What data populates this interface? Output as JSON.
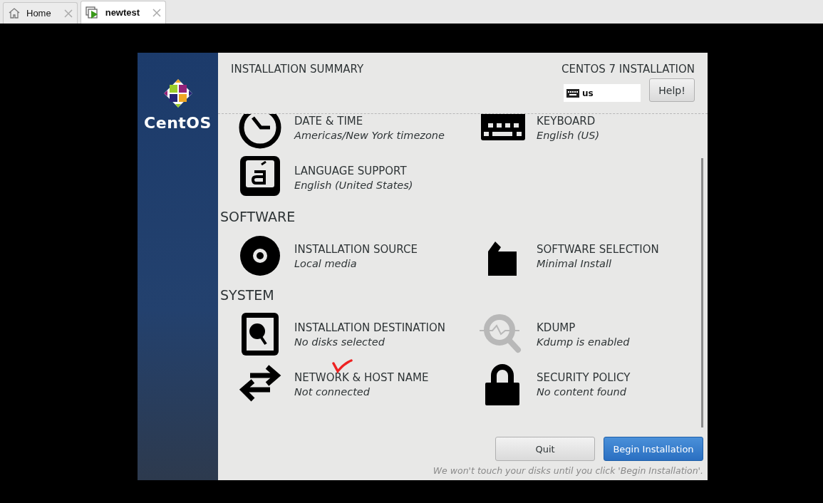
{
  "tabs": [
    {
      "kind": "home",
      "label": "Home",
      "selected": false
    },
    {
      "kind": "vm",
      "label": "newtest",
      "selected": true
    }
  ],
  "sidebar": {
    "logo_text": "CentOS"
  },
  "header": {
    "title": "INSTALLATION SUMMARY",
    "product": "CENTOS 7 INSTALLATION",
    "keyboard_layout": "us",
    "help_button": "Help!"
  },
  "sections": [
    {
      "spokes": [
        {
          "kind": "clock",
          "title": "DATE & TIME",
          "status": "Americas/New York timezone",
          "disabled": false
        },
        {
          "kind": "keyboard",
          "title": "KEYBOARD",
          "status": "English (US)",
          "disabled": false
        },
        {
          "kind": "language",
          "title": "LANGUAGE SUPPORT",
          "status": "English (United States)",
          "disabled": false
        }
      ]
    },
    {
      "heading": "SOFTWARE",
      "spokes": [
        {
          "kind": "disc",
          "title": "INSTALLATION SOURCE",
          "status": "Local media",
          "disabled": false
        },
        {
          "kind": "package",
          "title": "SOFTWARE SELECTION",
          "status": "Minimal Install",
          "disabled": false
        }
      ]
    },
    {
      "heading": "SYSTEM",
      "spokes": [
        {
          "kind": "harddisk",
          "title": "INSTALLATION DESTINATION",
          "status": "No disks selected",
          "disabled": false
        },
        {
          "kind": "magnifier",
          "title": "KDUMP",
          "status": "Kdump is enabled",
          "disabled": true
        },
        {
          "kind": "arrows",
          "title": "NETWORK & HOST NAME",
          "status": "Not connected",
          "disabled": false,
          "annotated": true
        },
        {
          "kind": "lock",
          "title": "SECURITY POLICY",
          "status": "No content found",
          "disabled": false
        }
      ]
    }
  ],
  "footer": {
    "buttons": [
      {
        "label": "Quit",
        "kind": "secondary"
      },
      {
        "label": "Begin Installation",
        "kind": "primary"
      }
    ],
    "note": "We won't touch your disks until you click 'Begin Installation'."
  }
}
